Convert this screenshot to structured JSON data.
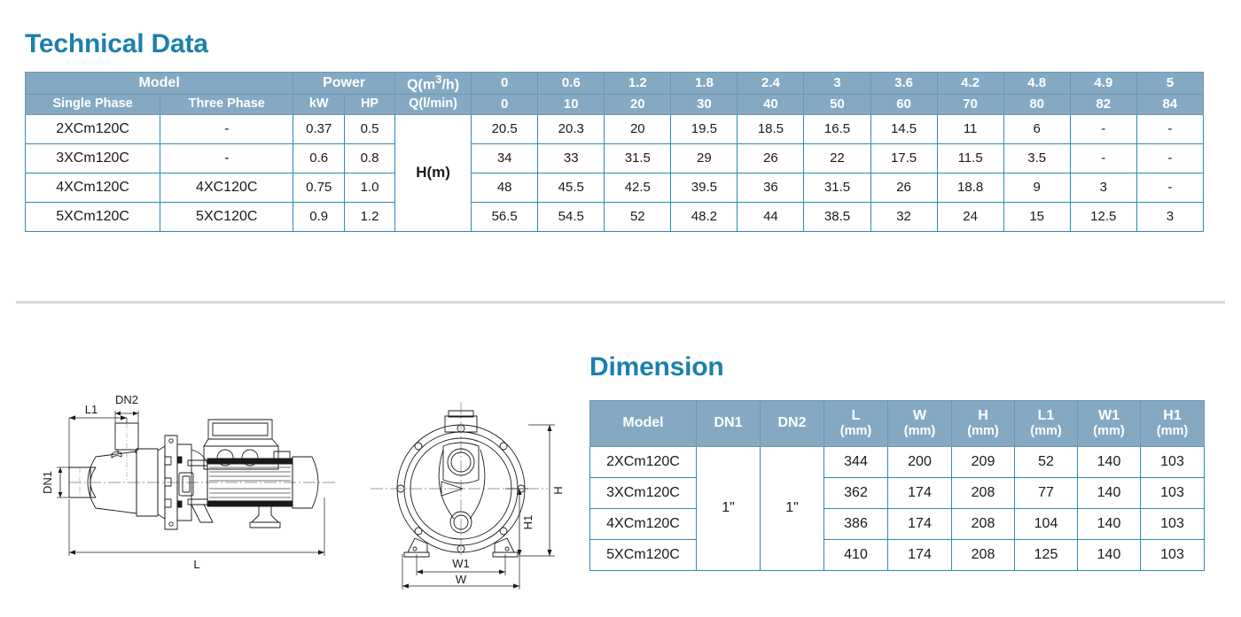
{
  "technical": {
    "title": "Technical Data",
    "header": {
      "model": "Model",
      "power": "Power",
      "q_m3h": "Q(m",
      "q_m3h_sup": "3",
      "q_m3h_tail": "/h)",
      "single_phase": "Single Phase",
      "three_phase": "Three Phase",
      "kw": "kW",
      "hp": "HP",
      "q_lmin": "Q(l/min)",
      "head_label": "H(m)"
    },
    "flow_m3h": [
      "0",
      "0.6",
      "1.2",
      "1.8",
      "2.4",
      "3",
      "3.6",
      "4.2",
      "4.8",
      "4.9",
      "5"
    ],
    "flow_lmin": [
      "0",
      "10",
      "20",
      "30",
      "40",
      "50",
      "60",
      "70",
      "80",
      "82",
      "84"
    ],
    "rows": [
      {
        "single_phase": "2XCm120C",
        "three_phase": "-",
        "kw": "0.37",
        "hp": "0.5",
        "head": [
          "20.5",
          "20.3",
          "20",
          "19.5",
          "18.5",
          "16.5",
          "14.5",
          "11",
          "6",
          "-",
          "-"
        ]
      },
      {
        "single_phase": "3XCm120C",
        "three_phase": "-",
        "kw": "0.6",
        "hp": "0.8",
        "head": [
          "34",
          "33",
          "31.5",
          "29",
          "26",
          "22",
          "17.5",
          "11.5",
          "3.5",
          "-",
          "-"
        ]
      },
      {
        "single_phase": "4XCm120C",
        "three_phase": "4XC120C",
        "kw": "0.75",
        "hp": "1.0",
        "head": [
          "48",
          "45.5",
          "42.5",
          "39.5",
          "36",
          "31.5",
          "26",
          "18.8",
          "9",
          "3",
          "-"
        ]
      },
      {
        "single_phase": "5XCm120C",
        "three_phase": "5XC120C",
        "kw": "0.9",
        "hp": "1.2",
        "head": [
          "56.5",
          "54.5",
          "52",
          "48.2",
          "44",
          "38.5",
          "32",
          "24",
          "15",
          "12.5",
          "3"
        ]
      }
    ]
  },
  "dimension": {
    "title": "Dimension",
    "header": {
      "model": "Model",
      "dn1": "DN1",
      "dn2": "DN2",
      "l": "L",
      "w": "W",
      "h": "H",
      "l1": "L1",
      "w1": "W1",
      "h1": "H1",
      "unit": "(mm)"
    },
    "dn1_value": "1\"",
    "dn2_value": "1\"",
    "rows": [
      {
        "model": "2XCm120C",
        "l": "344",
        "w": "200",
        "h": "209",
        "l1": "52",
        "w1": "140",
        "h1": "103"
      },
      {
        "model": "3XCm120C",
        "l": "362",
        "w": "174",
        "h": "208",
        "l1": "77",
        "w1": "140",
        "h1": "103"
      },
      {
        "model": "4XCm120C",
        "l": "386",
        "w": "174",
        "h": "208",
        "l1": "104",
        "w1": "140",
        "h1": "103"
      },
      {
        "model": "5XCm120C",
        "l": "410",
        "w": "174",
        "h": "208",
        "l1": "125",
        "w1": "140",
        "h1": "103"
      }
    ]
  },
  "drawing": {
    "side_view_labels": {
      "l1": "L1",
      "dn2": "DN2",
      "dn1": "DN1",
      "l": "L"
    },
    "front_view_labels": {
      "h": "H",
      "h1": "H1",
      "w1": "W1",
      "w": "W"
    }
  },
  "colors": {
    "title": "#1C80AD",
    "header_bg": "#85A9C2",
    "border": "#2E89B5",
    "divider": "#D8D8D8"
  }
}
